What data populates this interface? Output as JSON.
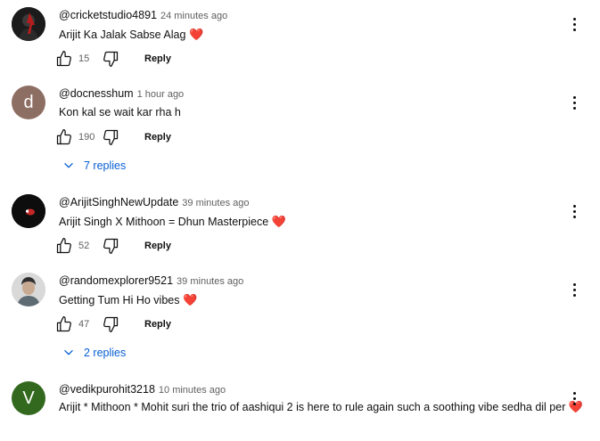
{
  "comments": [
    {
      "author": "@cricketstudio4891",
      "time": "24 minutes ago",
      "text": "Arijit Ka Jalak Sabse Alag",
      "heart": "❤️",
      "likes": "15",
      "reply_label": "Reply",
      "avatar_letter": "",
      "avatar_color": "#1b1b1b"
    },
    {
      "author": "@docnesshum",
      "time": "1 hour ago",
      "text": "Kon kal se wait kar rha h",
      "heart": "",
      "likes": "190",
      "reply_label": "Reply",
      "replies_label": "7 replies",
      "avatar_letter": "d",
      "avatar_color": "#8d6e63"
    },
    {
      "author": "@ArijitSinghNewUpdate",
      "time": "39 minutes ago",
      "text": "Arijit Singh X Mithoon = Dhun Masterpiece",
      "heart": "❤️",
      "likes": "52",
      "reply_label": "Reply",
      "avatar_letter": "",
      "avatar_color": "#111111"
    },
    {
      "author": "@randomexplorer9521",
      "time": "39 minutes ago",
      "text": "Getting Tum Hi Ho vibes",
      "heart": "❤️",
      "likes": "47",
      "reply_label": "Reply",
      "replies_label": "2 replies",
      "avatar_letter": "",
      "avatar_color": "#cfcfcf"
    },
    {
      "author": "@vedikpurohit3218",
      "time": "10 minutes ago",
      "text": "Arijit * Mithoon * Mohit suri the trio of aashiqui 2 is here to rule again such a soothing vibe sedha dil per",
      "heart": "❤️",
      "avatar_letter": "V",
      "avatar_color": "#33691e"
    }
  ],
  "icons": {
    "like": "thumb-up-icon",
    "dislike": "thumb-down-icon",
    "menu": "more-vert-icon",
    "expand": "chevron-down-icon"
  },
  "colors": {
    "link": "#065fd4",
    "heart": "#e02b3a",
    "secondary_text": "#606060"
  }
}
